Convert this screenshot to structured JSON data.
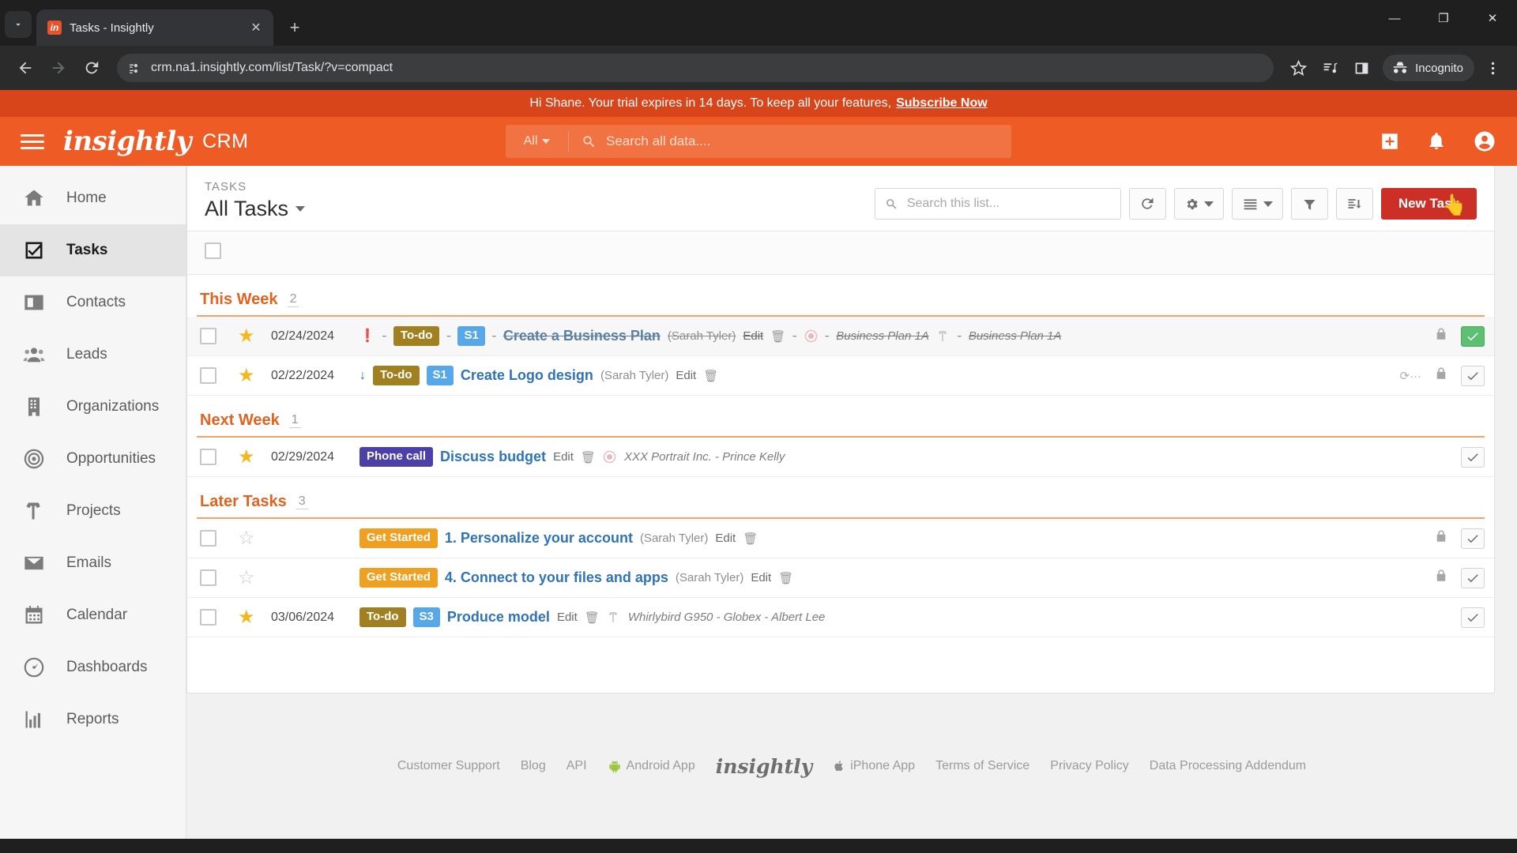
{
  "browser": {
    "tab": {
      "title": "Tasks - Insightly",
      "favicon_label": "in"
    },
    "newtab_label": "+",
    "close_label": "✕",
    "window": {
      "minimize": "—",
      "maximize": "❐",
      "close": "✕"
    },
    "url": "crm.na1.insightly.com/list/Task/?v=compact",
    "profile_label": "Incognito"
  },
  "banner": {
    "text": "Hi Shane. Your trial expires in 14 days. To keep all your features,",
    "link": "Subscribe Now"
  },
  "header": {
    "brand": "insightly",
    "product": "CRM",
    "search_scope": "All",
    "search_placeholder": "Search all data...."
  },
  "sidebar": {
    "items": [
      {
        "label": "Home",
        "icon": "home-icon",
        "active": false
      },
      {
        "label": "Tasks",
        "icon": "tasks-icon",
        "active": true
      },
      {
        "label": "Contacts",
        "icon": "contacts-icon",
        "active": false
      },
      {
        "label": "Leads",
        "icon": "leads-icon",
        "active": false
      },
      {
        "label": "Organizations",
        "icon": "organizations-icon",
        "active": false
      },
      {
        "label": "Opportunities",
        "icon": "opportunities-icon",
        "active": false
      },
      {
        "label": "Projects",
        "icon": "projects-icon",
        "active": false
      },
      {
        "label": "Emails",
        "icon": "emails-icon",
        "active": false
      },
      {
        "label": "Calendar",
        "icon": "calendar-icon",
        "active": false
      },
      {
        "label": "Dashboards",
        "icon": "dashboards-icon",
        "active": false
      },
      {
        "label": "Reports",
        "icon": "reports-icon",
        "active": false
      }
    ]
  },
  "list": {
    "eyebrow": "TASKS",
    "view_name": "All Tasks",
    "search_placeholder": "Search this list...",
    "new_button": "New Task",
    "toolbar_icons": [
      "refresh-icon",
      "gear-icon",
      "list-view-icon",
      "filter-icon",
      "sort-icon"
    ]
  },
  "groups": [
    {
      "name": "This Week",
      "count": "2",
      "rows": [
        {
          "date": "02/24/2024",
          "starred": true,
          "priority": "high",
          "priority_glyph": "❗",
          "pill": "To-do",
          "pill_type": "todo",
          "stage": "S1",
          "title": "Create a Business Plan",
          "owner": "(Sarah Tyler)",
          "edit": "Edit",
          "related": [
            {
              "icon": "contact-icon",
              "name": "Business Plan 1A"
            },
            {
              "icon": "project-icon",
              "name": "Business Plan 1A"
            }
          ],
          "completed": true,
          "locked": true,
          "check_state": "green",
          "spinner": false
        },
        {
          "date": "02/22/2024",
          "starred": true,
          "priority": "low",
          "priority_glyph": "↓",
          "pill": "To-do",
          "pill_type": "todo",
          "stage": "S1",
          "title": "Create Logo design",
          "owner": "(Sarah Tyler)",
          "edit": "Edit",
          "related": [],
          "completed": false,
          "locked": true,
          "check_state": "normal",
          "spinner": true,
          "spinner_text": "⟳···"
        }
      ]
    },
    {
      "name": "Next Week",
      "count": "1",
      "rows": [
        {
          "date": "02/29/2024",
          "starred": true,
          "priority": "",
          "priority_glyph": "",
          "pill": "Phone call",
          "pill_type": "phone",
          "stage": "",
          "title": "Discuss budget",
          "owner": "",
          "edit": "Edit",
          "related": [
            {
              "icon": "contact-icon",
              "name": "XXX Portrait Inc. - Prince Kelly"
            }
          ],
          "completed": false,
          "locked": false,
          "check_state": "normal",
          "spinner": false
        }
      ]
    },
    {
      "name": "Later Tasks",
      "count": "3",
      "rows": [
        {
          "date": "",
          "starred": false,
          "priority": "",
          "priority_glyph": "",
          "pill": "Get Started",
          "pill_type": "getstarted",
          "stage": "",
          "title": "1. Personalize your account",
          "owner": "(Sarah Tyler)",
          "edit": "Edit",
          "related": [],
          "completed": false,
          "locked": true,
          "check_state": "normal",
          "spinner": false
        },
        {
          "date": "",
          "starred": false,
          "priority": "",
          "priority_glyph": "",
          "pill": "Get Started",
          "pill_type": "getstarted",
          "stage": "",
          "title": "4. Connect to your files and apps",
          "owner": "(Sarah Tyler)",
          "edit": "Edit",
          "related": [],
          "completed": false,
          "locked": true,
          "check_state": "normal",
          "spinner": false
        },
        {
          "date": "03/06/2024",
          "starred": true,
          "priority": "",
          "priority_glyph": "",
          "pill": "To-do",
          "pill_type": "todo",
          "stage": "S3",
          "title": "Produce model",
          "owner": "",
          "edit": "Edit",
          "related": [
            {
              "icon": "project-icon",
              "name": "Whirlybird G950 - Globex - Albert Lee"
            }
          ],
          "completed": false,
          "locked": false,
          "check_state": "normal",
          "spinner": false
        }
      ]
    }
  ],
  "footer": {
    "links_left": [
      "Customer Support",
      "Blog",
      "API"
    ],
    "android": "Android App",
    "logo": "insightly",
    "iphone": "iPhone App",
    "links_right": [
      "Terms of Service",
      "Privacy Policy",
      "Data Processing Addendum"
    ]
  }
}
